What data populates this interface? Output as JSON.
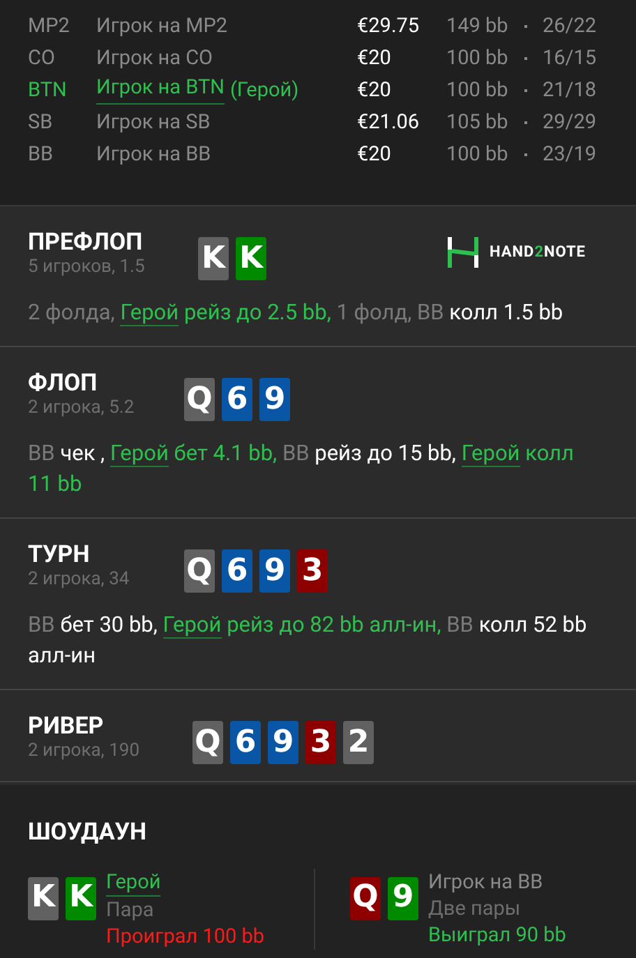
{
  "players": [
    {
      "position": "MP2",
      "name": "Игрок на MP2",
      "hero": false,
      "stack": "€29.75",
      "bb": "149 bb",
      "stat": "26/22"
    },
    {
      "position": "CO",
      "name": "Игрок на CO",
      "hero": false,
      "stack": "€20",
      "bb": "100 bb",
      "stat": "16/15"
    },
    {
      "position": "BTN",
      "name": "Игрок на BTN",
      "tag": "(Герой)",
      "hero": true,
      "stack": "€20",
      "bb": "100 bb",
      "stat": "21/18"
    },
    {
      "position": "SB",
      "name": "Игрок на SB",
      "hero": false,
      "stack": "€21.06",
      "bb": "105 bb",
      "stat": "29/29"
    },
    {
      "position": "BB",
      "name": "Игрок на BB",
      "hero": false,
      "stack": "€20",
      "bb": "100 bb",
      "stat": "23/19"
    }
  ],
  "streets": [
    {
      "title": "ПРЕФЛОП",
      "subtitle": "5 игроков, 1.5",
      "logo": {
        "prefix": "HAND",
        "digit": "2",
        "suffix": "NOTE"
      },
      "cards": [
        {
          "rank": "K",
          "color": "#616161"
        },
        {
          "rank": "K",
          "color": "#008a00"
        }
      ],
      "actions": [
        {
          "kind": "muted",
          "text": "2 фолда,"
        },
        {
          "kind": "hero_link",
          "text": "Герой"
        },
        {
          "kind": "hero",
          "text": "рейз до 2.5 bb,"
        },
        {
          "kind": "muted",
          "text": "1 фолд, BB"
        },
        {
          "kind": "plain",
          "text": "колл 1.5 bb"
        }
      ]
    },
    {
      "title": "ФЛОП",
      "subtitle": "2 игрока, 5.2",
      "cards": [
        {
          "rank": "Q",
          "color": "#616161"
        },
        {
          "rank": "6",
          "color": "#0a56a6"
        },
        {
          "rank": "9",
          "color": "#0a56a6"
        }
      ],
      "actions": [
        {
          "kind": "muted",
          "text": "BB"
        },
        {
          "kind": "plain",
          "text": "чек ,"
        },
        {
          "kind": "hero_link",
          "text": "Герой"
        },
        {
          "kind": "hero",
          "text": "бет 4.1 bb,"
        },
        {
          "kind": "muted",
          "text": "BB"
        },
        {
          "kind": "plain",
          "text": "рейз до 15 bb,"
        },
        {
          "kind": "hero_link",
          "text": "Герой"
        },
        {
          "kind": "hero",
          "text": "колл 11 bb"
        }
      ]
    },
    {
      "title": "ТУРН",
      "subtitle": "2 игрока, 34",
      "cards": [
        {
          "rank": "Q",
          "color": "#616161"
        },
        {
          "rank": "6",
          "color": "#0a56a6"
        },
        {
          "rank": "9",
          "color": "#0a56a6"
        },
        {
          "rank": "3",
          "color": "#8e0000"
        }
      ],
      "actions": [
        {
          "kind": "muted",
          "text": "BB"
        },
        {
          "kind": "plain",
          "text": "бет 30 bb,"
        },
        {
          "kind": "hero_link",
          "text": "Герой"
        },
        {
          "kind": "hero",
          "text": "рейз до 82 bb алл-ин,"
        },
        {
          "kind": "muted",
          "text": "BB"
        },
        {
          "kind": "plain",
          "text": "колл 52 bb алл-ин"
        }
      ]
    },
    {
      "title": "РИВЕР",
      "subtitle": "2 игрока, 190",
      "cards": [
        {
          "rank": "Q",
          "color": "#616161"
        },
        {
          "rank": "6",
          "color": "#0a56a6"
        },
        {
          "rank": "9",
          "color": "#0a56a6"
        },
        {
          "rank": "3",
          "color": "#8e0000"
        },
        {
          "rank": "2",
          "color": "#616161"
        }
      ]
    }
  ],
  "showdown": {
    "title": "ШОУДАУН",
    "hands": [
      {
        "name": "Герой",
        "hero": true,
        "combo": "Пара",
        "result": "Проиграл 100 bb",
        "won": false,
        "cards": [
          {
            "rank": "K",
            "color": "#616161"
          },
          {
            "rank": "K",
            "color": "#008a00"
          }
        ]
      },
      {
        "name": "Игрок на BB",
        "hero": false,
        "combo": "Две пары",
        "result": "Выиграл 90 bb",
        "won": true,
        "cards": [
          {
            "rank": "Q",
            "color": "#8e0000"
          },
          {
            "rank": "9",
            "color": "#008a00"
          }
        ]
      }
    ]
  }
}
